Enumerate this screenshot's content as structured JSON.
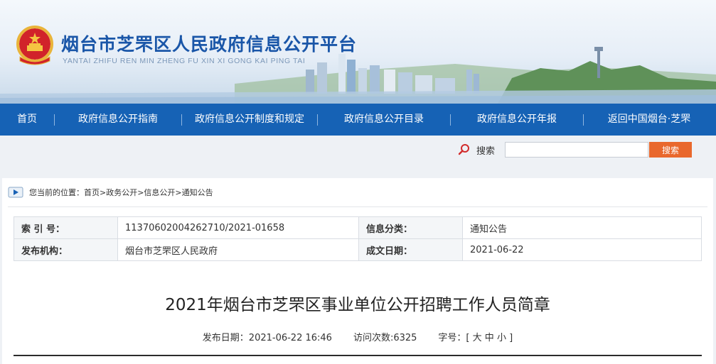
{
  "header": {
    "site_title": "烟台市芝罘区人民政府信息公开平台",
    "site_pinyin": "YANTAI ZHIFU REN MIN ZHENG FU XIN XI GONG KAI PING TAI"
  },
  "nav": {
    "items": [
      {
        "label": "首页"
      },
      {
        "label": "政府信息公开指南"
      },
      {
        "label": "政府信息公开制度和规定"
      },
      {
        "label": "政府信息公开目录"
      },
      {
        "label": "政府信息公开年报"
      },
      {
        "label": "返回中国烟台·芝罘"
      }
    ]
  },
  "search": {
    "label": "搜索",
    "placeholder": "",
    "button_label": "搜索"
  },
  "breadcrumb": {
    "text": "您当前的位置：首页>政务公开>信息公开>通知公告"
  },
  "meta": {
    "index_label": "索 引 号：",
    "index_value": "11370602004262710/2021-01658",
    "category_label": "信息分类：",
    "category_value": "通知公告",
    "publisher_label": "发布机构：",
    "publisher_value": "烟台市芝罘区人民政府",
    "date_label": "成文日期：",
    "date_value": "2021-06-22"
  },
  "article": {
    "title": "2021年烟台市芝罘区事业单位公开招聘工作人员简章",
    "publish_date": "发布日期：2021-06-22 16:46",
    "visits": "访问次数:6325",
    "font_size_label": "字号：[",
    "font_large": "大",
    "font_medium": "中",
    "font_small": "小",
    "font_size_close": "]"
  },
  "colors": {
    "nav_bg": "#1662b5",
    "title_blue": "#1a56a8",
    "search_button": "#e9682d"
  }
}
